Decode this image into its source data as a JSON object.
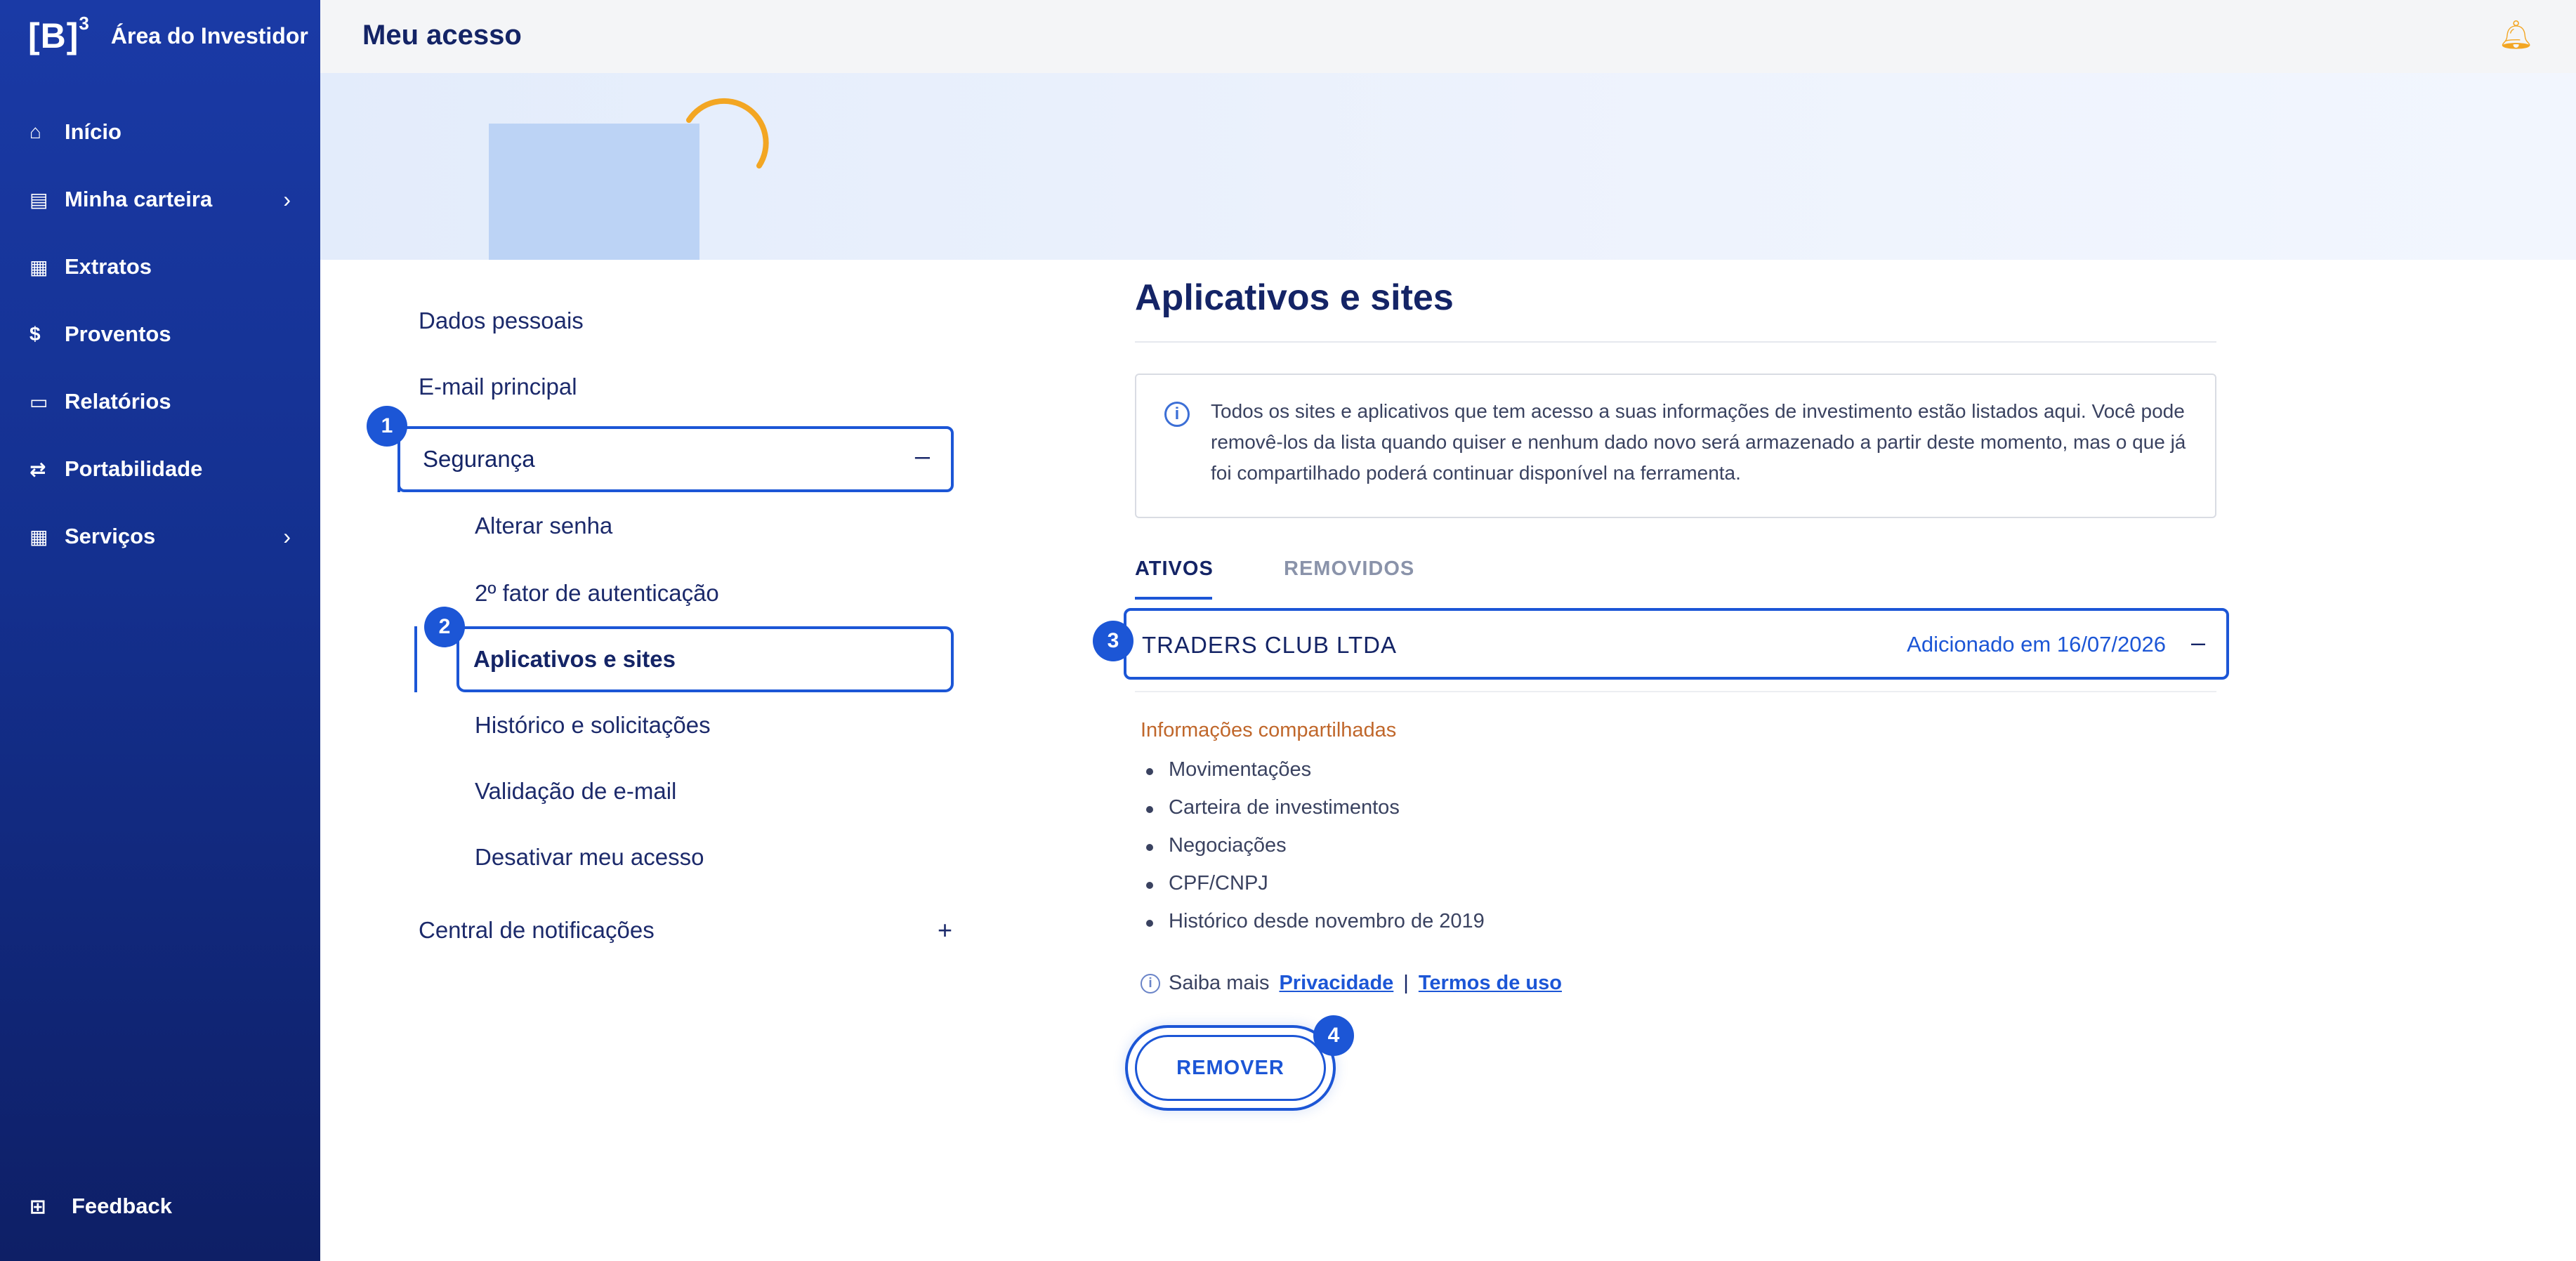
{
  "sidebar": {
    "logo_mark": "[B]",
    "logo_superscript": "3",
    "app_name": "Área do Investidor",
    "items": [
      {
        "label": "Início",
        "icon": "home-icon",
        "has_chevron": false
      },
      {
        "label": "Minha carteira",
        "icon": "wallet-icon",
        "has_chevron": true
      },
      {
        "label": "Extratos",
        "icon": "grid-icon",
        "has_chevron": false
      },
      {
        "label": "Proventos",
        "icon": "dollar-icon",
        "has_chevron": false
      },
      {
        "label": "Relatórios",
        "icon": "report-icon",
        "has_chevron": false
      },
      {
        "label": "Portabilidade",
        "icon": "transfer-icon",
        "has_chevron": false
      },
      {
        "label": "Serviços",
        "icon": "grid-icon",
        "has_chevron": true
      }
    ],
    "feedback_label": "Feedback"
  },
  "header": {
    "title": "Meu acesso",
    "bell_icon": "bell-icon"
  },
  "menu": {
    "dados_pessoais": "Dados pessoais",
    "email_principal": "E-mail principal",
    "seguranca": "Segurança",
    "seguranca_toggle": "–",
    "sub_items": {
      "alterar_senha": "Alterar senha",
      "segundo_fator": "2º fator de autenticação",
      "aplicativos": "Aplicativos e sites",
      "historico": "Histórico e solicitações",
      "validacao": "Validação de e-mail",
      "desativar": "Desativar meu acesso"
    },
    "central": "Central de notificações",
    "central_toggle": "+"
  },
  "badges": [
    "1",
    "2",
    "3",
    "4"
  ],
  "content": {
    "title": "Aplicativos e sites",
    "info_text": "Todos os sites e aplicativos que tem acesso a suas informações de investimento estão listados aqui. Você pode removê-los da lista quando quiser e nenhum dado novo será armazenado a partir deste momento, mas o que já foi compartilhado poderá continuar disponível na ferramenta.",
    "tabs": {
      "active": "ATIVOS",
      "inactive": "REMOVIDOS"
    },
    "app": {
      "name": "TRADERS CLUB LTDA",
      "added": "Adicionado em 16/07/2026",
      "toggle": "–"
    },
    "shared_title": "Informações compartilhadas",
    "shared_items": [
      "Movimentações",
      "Carteira de investimentos",
      "Negociações",
      "CPF/CNPJ",
      "Histórico desde novembro de 2019"
    ],
    "saiba_mais": "Saiba mais",
    "privacidade": "Privacidade",
    "separator": "|",
    "termos": "Termos de uso",
    "remove_button": "REMOVER"
  },
  "colors": {
    "sidebar_top": "#1a3aa6",
    "sidebar_bottom": "#0e1f66",
    "accent": "#1c56d6",
    "bell": "#f3a623",
    "shared_title": "#c0672b"
  }
}
